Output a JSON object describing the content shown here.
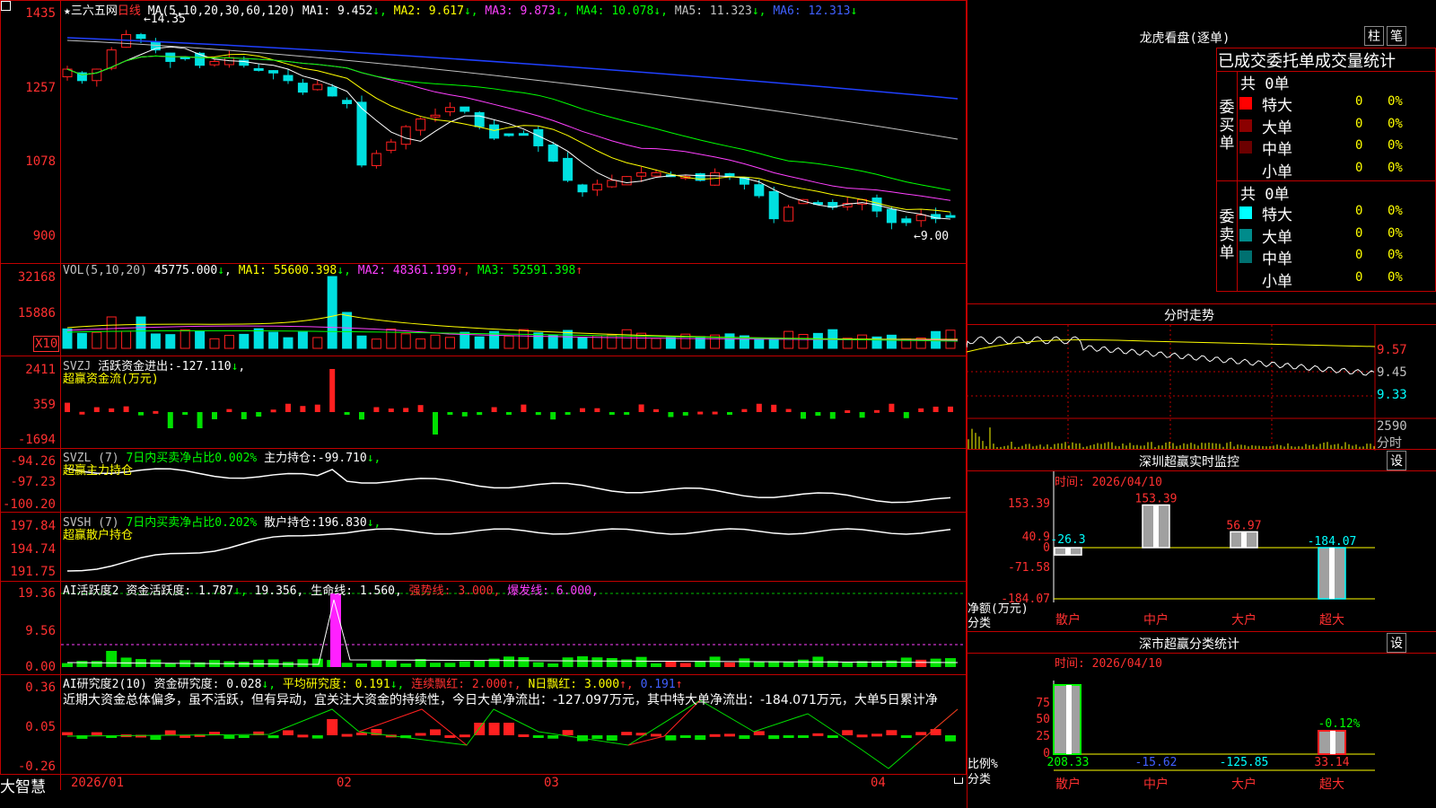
{
  "main": {
    "stock_name": "三六五网",
    "period": "日线",
    "star": "★",
    "high_marker": "14.35",
    "low_marker": "9.00",
    "ma_label": "MA(5,10,20,30,60,120)",
    "ma": [
      {
        "label": "MA1:",
        "value": "9.452",
        "arrow": "↓",
        "color": "#ffffff"
      },
      {
        "label": "MA2:",
        "value": "9.617",
        "arrow": "↓",
        "color": "#ffff00"
      },
      {
        "label": "MA3:",
        "value": "9.873",
        "arrow": "↓",
        "color": "#ff40ff"
      },
      {
        "label": "MA4:",
        "value": "10.078",
        "arrow": "↓",
        "color": "#00ff00"
      },
      {
        "label": "MA5:",
        "value": "11.323",
        "arrow": "↓",
        "color": "#c0c0c0"
      },
      {
        "label": "MA6:",
        "value": "12.313",
        "arrow": "↓",
        "color": "#4060ff"
      }
    ],
    "y_ticks": [
      "1435",
      "1257",
      "1078",
      "900"
    ]
  },
  "vol": {
    "label": "VOL(5,10,20)",
    "value": "45775.000",
    "arrow": "↓",
    "ma": [
      {
        "label": "MA1:",
        "value": "55600.398",
        "arrow": "↓",
        "color": "#ffff00"
      },
      {
        "label": "MA2:",
        "value": "48361.199",
        "arrow": "↑",
        "color": "#ff40ff"
      },
      {
        "label": "MA3:",
        "value": "52591.398",
        "arrow": "↑",
        "color": "#00ff00"
      }
    ],
    "y_ticks": [
      "32168",
      "15886"
    ],
    "unit": "X10"
  },
  "svzj": {
    "label": "SVZJ",
    "text": "活跃资金进出:",
    "value": "-127.110",
    "arrow": "↓",
    "sub": "超赢资金流(万元)",
    "y_ticks": [
      "2411",
      "359",
      "-1694"
    ]
  },
  "svzl": {
    "label": "SVZL (7)",
    "text1": "7日内买卖净占比0.002%",
    "text2": "主力持仓:",
    "value": "-99.710",
    "arrow": "↓,",
    "sub": "超赢主力持仓",
    "y_ticks": [
      "-94.26",
      "-97.23",
      "-100.20"
    ]
  },
  "svsh": {
    "label": "SVSH (7)",
    "text1": "7日内买卖净占比0.202%",
    "text2": "散户持仓:",
    "value": "196.830",
    "arrow": "↓,",
    "sub": "超赢散户持仓",
    "y_ticks": [
      "197.84",
      "194.74",
      "191.75"
    ]
  },
  "ai1": {
    "label": "AI活跃度2",
    "text1": "资金活跃度:",
    "v1": "1.787",
    "a1": "↓,",
    "v2": "19.356,",
    "text2": "生命线:",
    "v3": "1.560,",
    "text3": "强势线:",
    "v4": "3.000,",
    "text4": "爆发线:",
    "v5": "6.000,",
    "y_ticks": [
      "19.36",
      "9.56",
      "0.00"
    ]
  },
  "ai2": {
    "label": "AI研究度2(10)",
    "text1": "资金研究度:",
    "v1": "0.028",
    "a1": "↓,",
    "text2": "平均研究度:",
    "v2": "0.191",
    "a2": "↓,",
    "text3": "连续飘红:",
    "v3": "2.000",
    "a3": "↑,",
    "text4": "N日飘红:",
    "v4": "3.000",
    "a4": "↑,",
    "v5": "0.191",
    "a5": "↑",
    "comment": "近期大资金总体偏多，虽不活跃，但有异动，宜关注大资金的持续性，今日大单净流出：-127.097万元，其中特大单净流出：-184.071万元，大单5日累计净",
    "y_ticks": [
      "0.36",
      "0.05",
      "-0.26"
    ]
  },
  "axis": {
    "brand": "大智慧",
    "dates": [
      "2026/01",
      "02",
      "03",
      "04"
    ]
  },
  "right": {
    "dragon_title": "龙虎看盘(逐单)",
    "btn_zhu": "柱",
    "btn_bi": "笔",
    "stat_title": "已成交委托单成交量统计",
    "buy_label": "委买单",
    "sell_label": "委卖单",
    "buy_total": "共 0单",
    "sell_total": "共 0单",
    "buy_rows": [
      {
        "name": "特大",
        "count": "0",
        "pct": "0%",
        "color": "#ff0000"
      },
      {
        "name": "大单",
        "count": "0",
        "pct": "0%",
        "color": "#8b0000"
      },
      {
        "name": "中单",
        "count": "0",
        "pct": "0%",
        "color": "#6b0000"
      },
      {
        "name": "小单",
        "count": "0",
        "pct": "0%",
        "color": "#000000"
      }
    ],
    "sell_rows": [
      {
        "name": "特大",
        "count": "0",
        "pct": "0%",
        "color": "#00ffff"
      },
      {
        "name": "大单",
        "count": "0",
        "pct": "0%",
        "color": "#008b8b"
      },
      {
        "name": "中单",
        "count": "0",
        "pct": "0%",
        "color": "#007070"
      },
      {
        "name": "小单",
        "count": "0",
        "pct": "0%",
        "color": "#000000"
      }
    ],
    "intraday_title": "分时走势",
    "intraday_y": [
      "9.57",
      "9.45",
      "9.33"
    ],
    "intraday_vol": "2590",
    "intraday_unit": "分时",
    "monitor_title": "深圳超赢实时监控",
    "monitor_btn": "设",
    "monitor_date": "时间: 2026/04/10",
    "monitor_y": [
      "153.39",
      "40.9",
      "0",
      "-71.58",
      "-184.07"
    ],
    "monitor_bars": [
      {
        "name": "散户",
        "value": "-26.3"
      },
      {
        "name": "中户",
        "value": "153.39"
      },
      {
        "name": "大户",
        "value": "56.97"
      },
      {
        "name": "超大",
        "value": "-184.07"
      }
    ],
    "monitor_ylabel": "净额(万元)",
    "monitor_xlabel": "分类",
    "class_title": "深市超赢分类统计",
    "class_btn": "设",
    "class_date": "时间: 2026/04/10",
    "class_y": [
      "75",
      "50",
      "25",
      "0"
    ],
    "class_bars": [
      {
        "name": "散户",
        "value": "208.33"
      },
      {
        "name": "中户",
        "value": "-15.62"
      },
      {
        "name": "大户",
        "value": "-125.85"
      },
      {
        "name": "超大",
        "value": "33.14"
      }
    ],
    "class_extra": "-0.12%",
    "class_ylabel": "比例%",
    "class_xlabel": "分类"
  }
}
